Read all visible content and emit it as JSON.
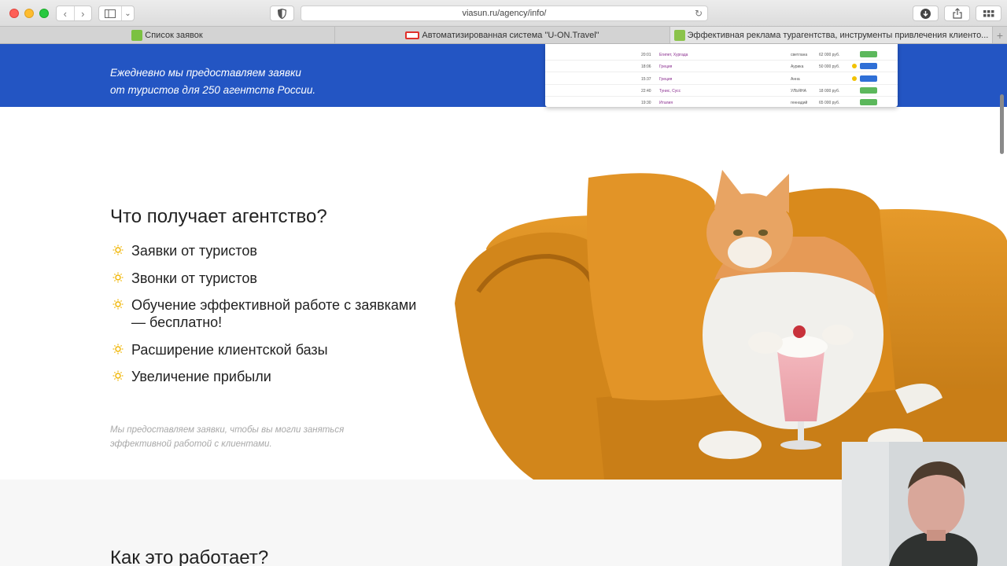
{
  "browser": {
    "url": "viasun.ru/agency/info/",
    "tabs": [
      {
        "label": "Список заявок",
        "favicon": "green-square-icon"
      },
      {
        "label": "Автоматизированная система \"U-ON.Travel\"",
        "favicon": "uon-red-icon"
      },
      {
        "label": "Эффективная реклама турагентства, инструменты привлечения клиенто...",
        "favicon": "palm-icon",
        "active": true
      }
    ]
  },
  "banner": {
    "text_line1": "Ежедневно мы предоставляем заявки",
    "text_line2": "от туристов для 250 агентств России.",
    "bg_color": "#2355c3"
  },
  "mini_table": {
    "rows": [
      {
        "time": "20:01",
        "dest": "Египет, Хургада",
        "name": "светлана",
        "price": "62 000 руб.",
        "status_color": "#5cb85c"
      },
      {
        "time": "18:06",
        "dest": "Греция",
        "name": "Аурика",
        "price": "50 000 руб.",
        "status_color": "#2f6fd6"
      },
      {
        "time": "15:37",
        "dest": "Греция",
        "name": "Анна",
        "price": "",
        "status_color": "#2f6fd6"
      },
      {
        "time": "22:40",
        "dest": "Тунис, Сусс",
        "name": "УЛЬЯНА",
        "price": "18 000 руб.",
        "status_color": "#5cb85c"
      },
      {
        "time": "19:30",
        "dest": "Италия",
        "name": "геннадий",
        "price": "65 000 руб.",
        "status_color": "#5cb85c"
      }
    ]
  },
  "section": {
    "title": "Что получает агентство?",
    "benefits": [
      "Заявки от туристов",
      "Звонки от туристов",
      "Обучение эффективной работе с заявками — бесплатно!",
      "Расширение клиентской базы",
      "Увеличение прибыли"
    ],
    "caption_line1": "Мы предоставляем заявки, чтобы вы могли заняться",
    "caption_line2": "эффективной работой с клиентами."
  },
  "next_section": {
    "title": "Как это работает?"
  },
  "colors": {
    "accent_sun": "#f0b400",
    "sofa": "#d98a1c"
  }
}
